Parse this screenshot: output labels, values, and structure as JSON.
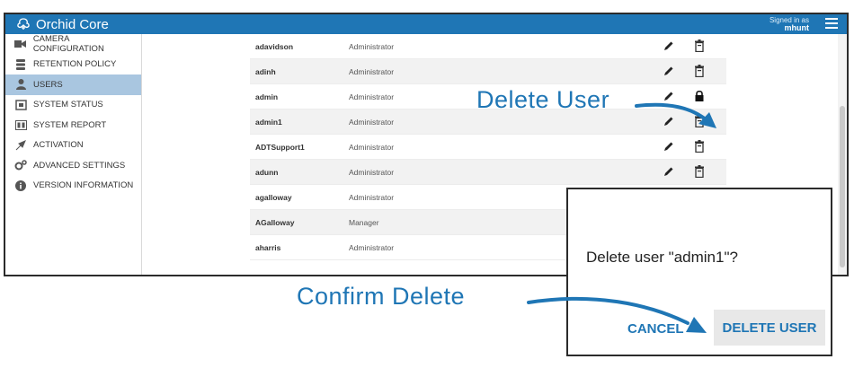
{
  "app": {
    "brand": "Orchid Core",
    "signed_in_label": "Signed in as",
    "signed_in_user": "mhunt"
  },
  "sidebar": {
    "items": [
      {
        "label": "CAMERA CONFIGURATION",
        "icon": "camera-icon"
      },
      {
        "label": "RETENTION POLICY",
        "icon": "database-icon"
      },
      {
        "label": "USERS",
        "icon": "user-icon",
        "active": true
      },
      {
        "label": "SYSTEM STATUS",
        "icon": "status-icon"
      },
      {
        "label": "SYSTEM REPORT",
        "icon": "report-icon"
      },
      {
        "label": "ACTIVATION",
        "icon": "activation-icon"
      },
      {
        "label": "ADVANCED SETTINGS",
        "icon": "settings-icon"
      },
      {
        "label": "VERSION INFORMATION",
        "icon": "info-icon"
      }
    ]
  },
  "users": [
    {
      "name": "adavidson",
      "role": "Administrator",
      "action": "delete"
    },
    {
      "name": "adinh",
      "role": "Administrator",
      "action": "delete"
    },
    {
      "name": "admin",
      "role": "Administrator",
      "action": "lock"
    },
    {
      "name": "admin1",
      "role": "Administrator",
      "action": "delete"
    },
    {
      "name": "ADTSupport1",
      "role": "Administrator",
      "action": "delete"
    },
    {
      "name": "adunn",
      "role": "Administrator",
      "action": "delete"
    },
    {
      "name": "agalloway",
      "role": "Administrator",
      "action": "none"
    },
    {
      "name": "AGalloway",
      "role": "Manager",
      "action": "none"
    },
    {
      "name": "aharris",
      "role": "Administrator",
      "action": "none"
    }
  ],
  "dialog": {
    "message": "Delete user \"admin1\"?",
    "cancel_label": "CANCEL",
    "delete_label": "DELETE USER"
  },
  "callouts": {
    "delete_user": "Delete User",
    "confirm_delete": "Confirm Delete"
  },
  "colors": {
    "accent": "#1f76b5",
    "active_row": "#a9c6e0"
  }
}
